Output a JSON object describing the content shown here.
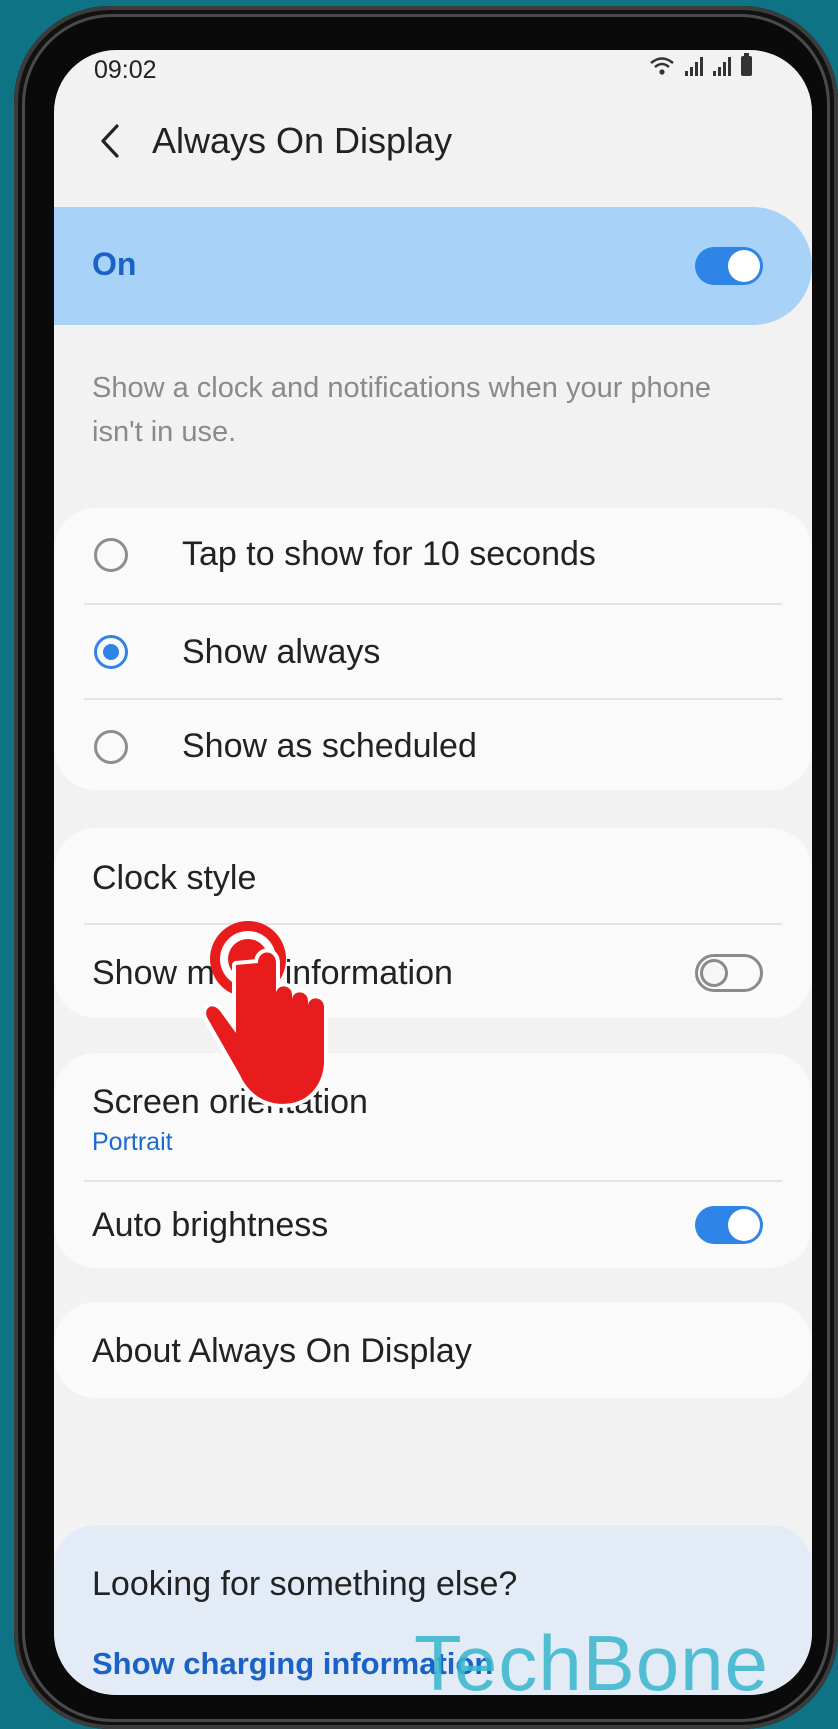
{
  "status_bar": {
    "time": "09:02"
  },
  "header": {
    "title": "Always On Display"
  },
  "master_switch": {
    "label": "On",
    "state": "on"
  },
  "description": "Show a clock and notifications when your phone isn't in use.",
  "display_mode": {
    "options": [
      {
        "label": "Tap to show for 10 seconds",
        "selected": false
      },
      {
        "label": "Show always",
        "selected": true
      },
      {
        "label": "Show as scheduled",
        "selected": false
      }
    ]
  },
  "clock_section": {
    "clock_style": "Clock style",
    "show_music": "Show music information",
    "show_music_state": "off"
  },
  "display_section": {
    "screen_orientation": "Screen orientation",
    "screen_orientation_value": "Portrait",
    "auto_brightness": "Auto brightness",
    "auto_brightness_state": "on"
  },
  "about": "About Always On Display",
  "footer": {
    "title": "Looking for something else?",
    "link": "Show charging information"
  },
  "watermark": "TechBone",
  "colors": {
    "accent": "#2f84e8",
    "master_bg": "#a9d2f8",
    "page_bg": "#0f7386",
    "tap_hand": "#e81c1c"
  }
}
